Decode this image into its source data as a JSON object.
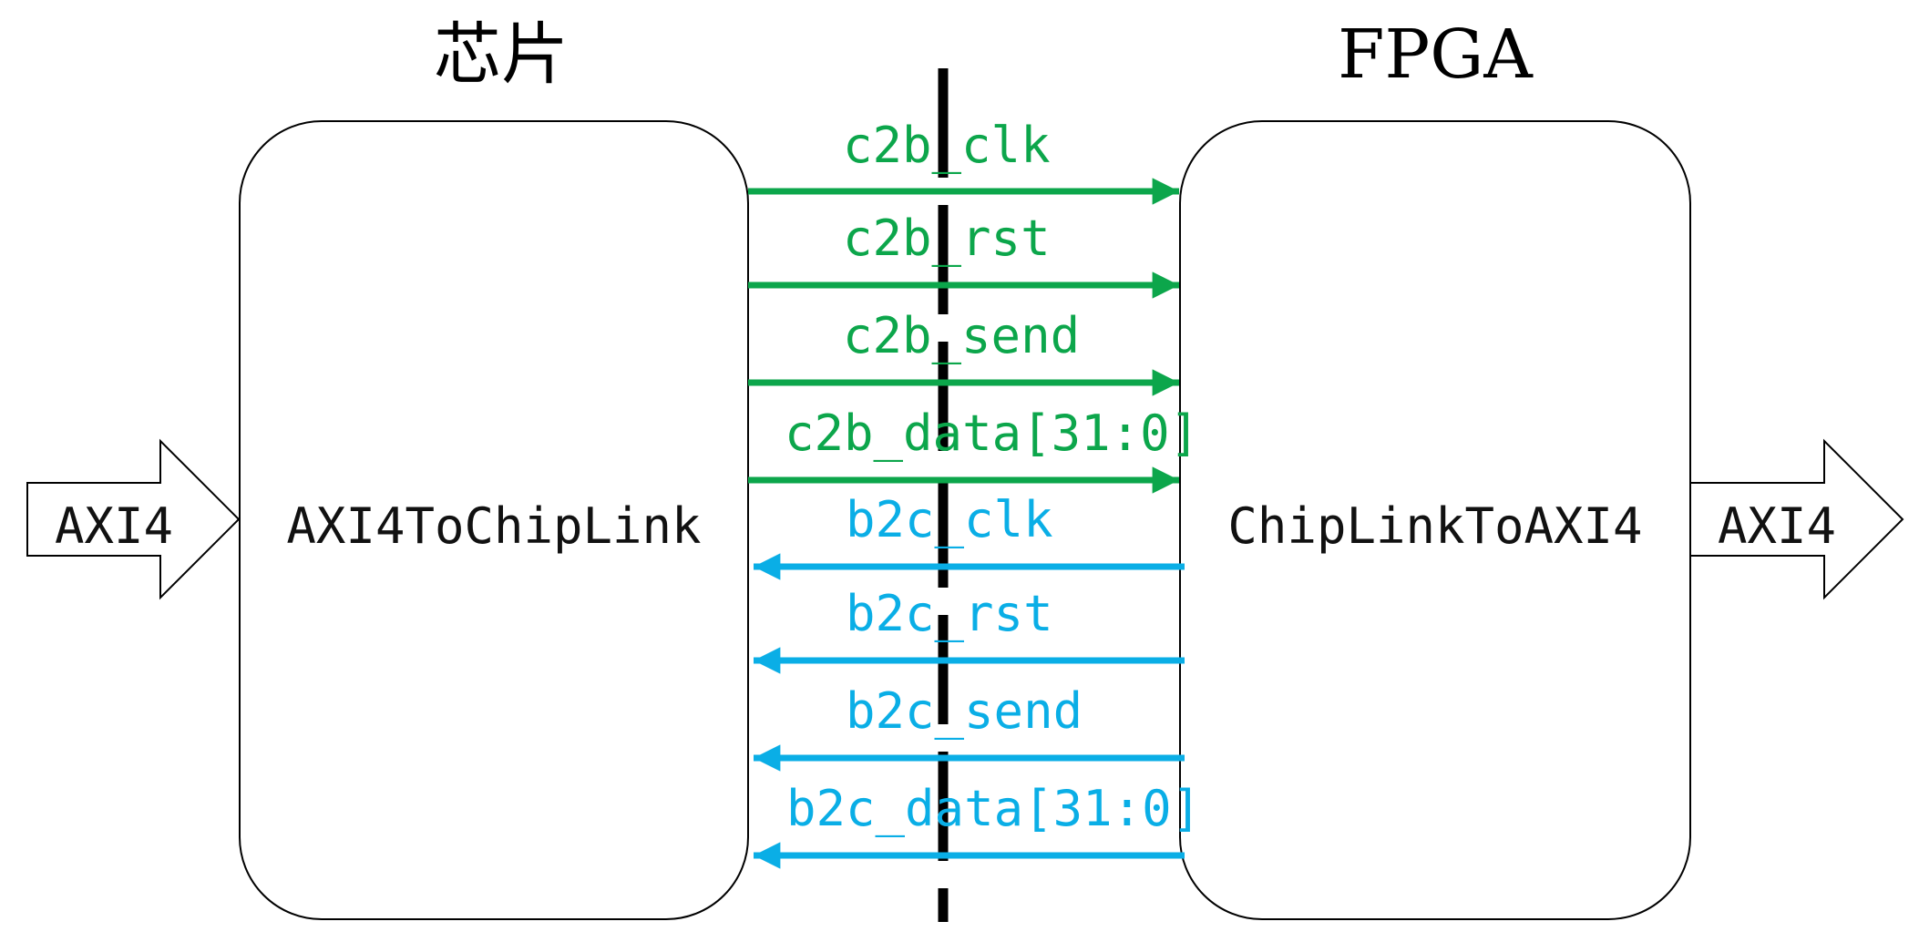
{
  "titles": {
    "left": "芯片",
    "right": "FPGA"
  },
  "blocks": {
    "left": "AXI4ToChipLink",
    "right": "ChipLinkToAXI4"
  },
  "bus": {
    "left": "AXI4",
    "right": "AXI4"
  },
  "colors": {
    "c2b": "#0ca64b",
    "b2c": "#0aaee6",
    "divider": "#000000"
  },
  "signals_c2b": [
    "c2b_clk",
    "c2b_rst",
    "c2b_send",
    "c2b_data[31:0]"
  ],
  "signals_b2c": [
    "b2c_clk",
    "b2c_rst",
    "b2c_send",
    "b2c_data[31:0]"
  ]
}
